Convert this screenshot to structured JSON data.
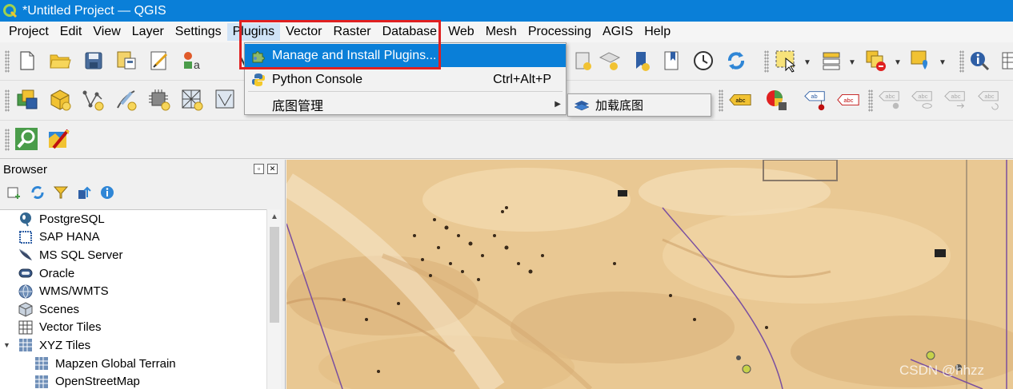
{
  "window": {
    "title": "*Untitled Project — QGIS"
  },
  "menubar": [
    {
      "label": "Project"
    },
    {
      "label": "Edit"
    },
    {
      "label": "View"
    },
    {
      "label": "Layer"
    },
    {
      "label": "Settings"
    },
    {
      "label": "Plugins"
    },
    {
      "label": "Vector"
    },
    {
      "label": "Raster"
    },
    {
      "label": "Database"
    },
    {
      "label": "Web"
    },
    {
      "label": "Mesh"
    },
    {
      "label": "Processing"
    },
    {
      "label": "AGIS"
    },
    {
      "label": "Help"
    }
  ],
  "plugins_menu": {
    "items": [
      {
        "label": "Manage and Install Plugins...",
        "icon": "puzzle-icon",
        "shortcut": ""
      },
      {
        "label": "Python Console",
        "icon": "python-icon",
        "shortcut": "Ctrl+Alt+P"
      },
      {
        "label": "底图管理",
        "icon": "",
        "shortcut": ""
      }
    ],
    "submenu": {
      "label": "加载底图",
      "icon": "basemap-layers-icon"
    }
  },
  "browser": {
    "title": "Browser",
    "items": [
      {
        "label": "PostgreSQL",
        "icon": "postgresql-icon"
      },
      {
        "label": "SAP HANA",
        "icon": "sap-hana-icon"
      },
      {
        "label": "MS SQL Server",
        "icon": "mssql-icon"
      },
      {
        "label": "Oracle",
        "icon": "oracle-icon"
      },
      {
        "label": "WMS/WMTS",
        "icon": "wms-globe-icon"
      },
      {
        "label": "Scenes",
        "icon": "scenes-cube-icon"
      },
      {
        "label": "Vector Tiles",
        "icon": "vector-tiles-icon"
      },
      {
        "label": "XYZ Tiles",
        "icon": "xyz-tiles-icon"
      },
      {
        "label": "Mapzen Global Terrain",
        "icon": "xyz-tiles-icon"
      },
      {
        "label": "OpenStreetMap",
        "icon": "xyz-tiles-icon"
      }
    ]
  },
  "toolbar_labels": {
    "abc": "abc",
    "ab": "ab"
  },
  "watermark": "CSDN @hhzz",
  "colors": {
    "titlebar": "#0a7fd8",
    "highlight": "#0a7fd8",
    "callout": "#e02020",
    "map_sand": "#e8c794"
  }
}
